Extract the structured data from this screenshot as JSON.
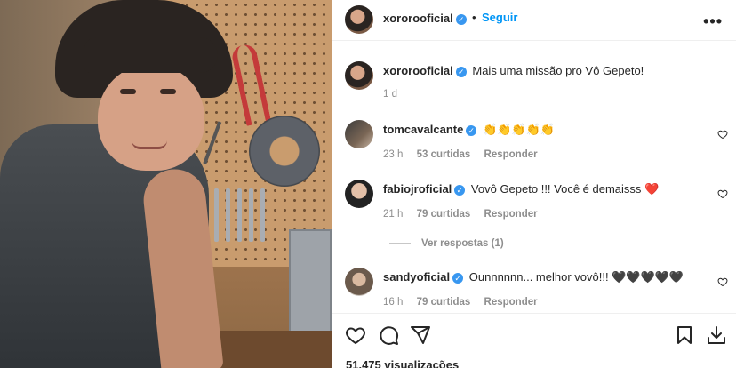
{
  "post": {
    "author": "xororooficial",
    "follow_label": "Seguir",
    "separator": "•",
    "more_label": "•••",
    "caption": "Mais uma missão pro Vô Gepeto!",
    "caption_time": "1 d"
  },
  "comments": [
    {
      "username": "tomcavalcante",
      "text": "👏👏👏👏👏",
      "time": "23 h",
      "likes": "53 curtidas",
      "reply": "Responder"
    },
    {
      "username": "fabiojroficial",
      "text": "Vovô Gepeto !!! Você é demaisss ❤️",
      "time": "21 h",
      "likes": "79 curtidas",
      "reply": "Responder"
    },
    {
      "username": "sandyoficial",
      "text": "Ounnnnnn... melhor vovô!!! 🖤🖤🖤🖤🖤",
      "time": "16 h",
      "likes": "79 curtidas",
      "reply": "Responder"
    }
  ],
  "view_replies": "Ver respostas (1)",
  "views": "51.475 visualizações",
  "colors": {
    "accent": "#0095f6",
    "verified": "#3897f0",
    "muted": "#8e8e8e",
    "text": "#262626"
  },
  "icons": [
    "heart-icon",
    "comment-icon",
    "share-icon",
    "bookmark-icon",
    "download-icon",
    "verified-badge-icon",
    "more-icon"
  ]
}
